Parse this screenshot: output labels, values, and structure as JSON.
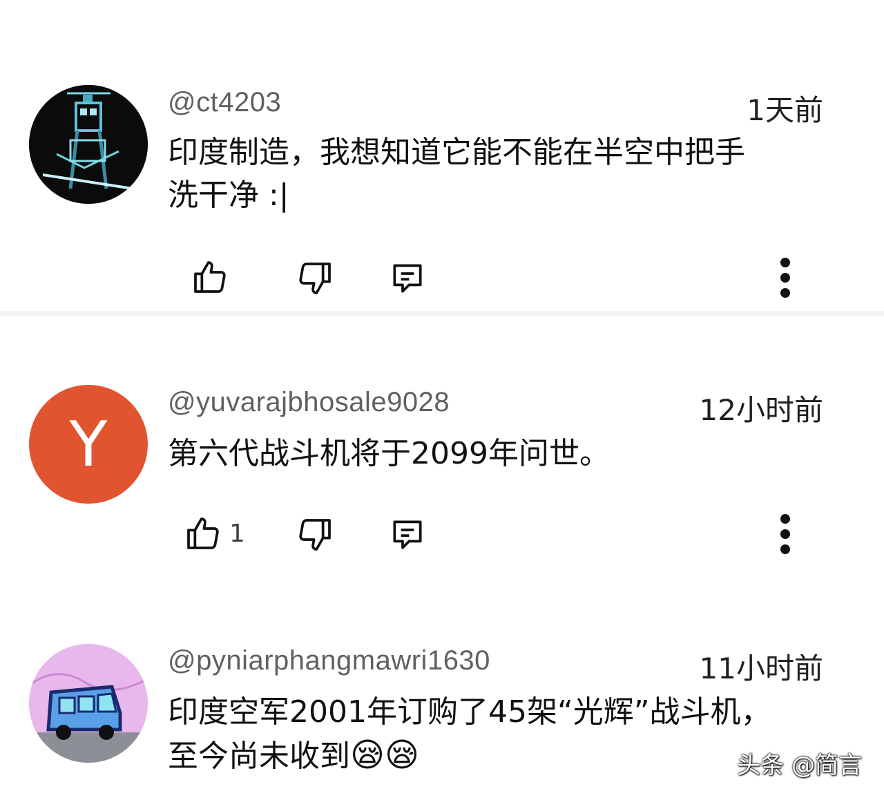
{
  "comments": [
    {
      "username": "@ct4203",
      "time": "1天前",
      "text_line1": "印度制造，我想知道它能不能在半空中把手",
      "text_line2": "洗干净 :|",
      "like_count": "",
      "avatar_type": "image",
      "avatar_bg": "#0b0b0b"
    },
    {
      "username": "@yuvarajbhosale9028",
      "time": "12小时前",
      "text_line1": "第六代战斗机将于2099年问世。",
      "like_count": "1",
      "avatar_letter": "Y",
      "avatar_bg": "#e0552f"
    },
    {
      "username": "@pyniarphangmawri1630",
      "time": "11小时前",
      "text_line1": "印度空军2001年订购了45架“光辉”战斗机，",
      "text_line2": "至今尚未收到",
      "emoji": "😪😪",
      "avatar_type": "image",
      "avatar_bg": "#e8b8ec"
    }
  ],
  "watermark": "头条 @简言",
  "icons": [
    "thumb-up-icon",
    "thumb-down-icon",
    "reply-icon",
    "more-vertical-icon"
  ]
}
